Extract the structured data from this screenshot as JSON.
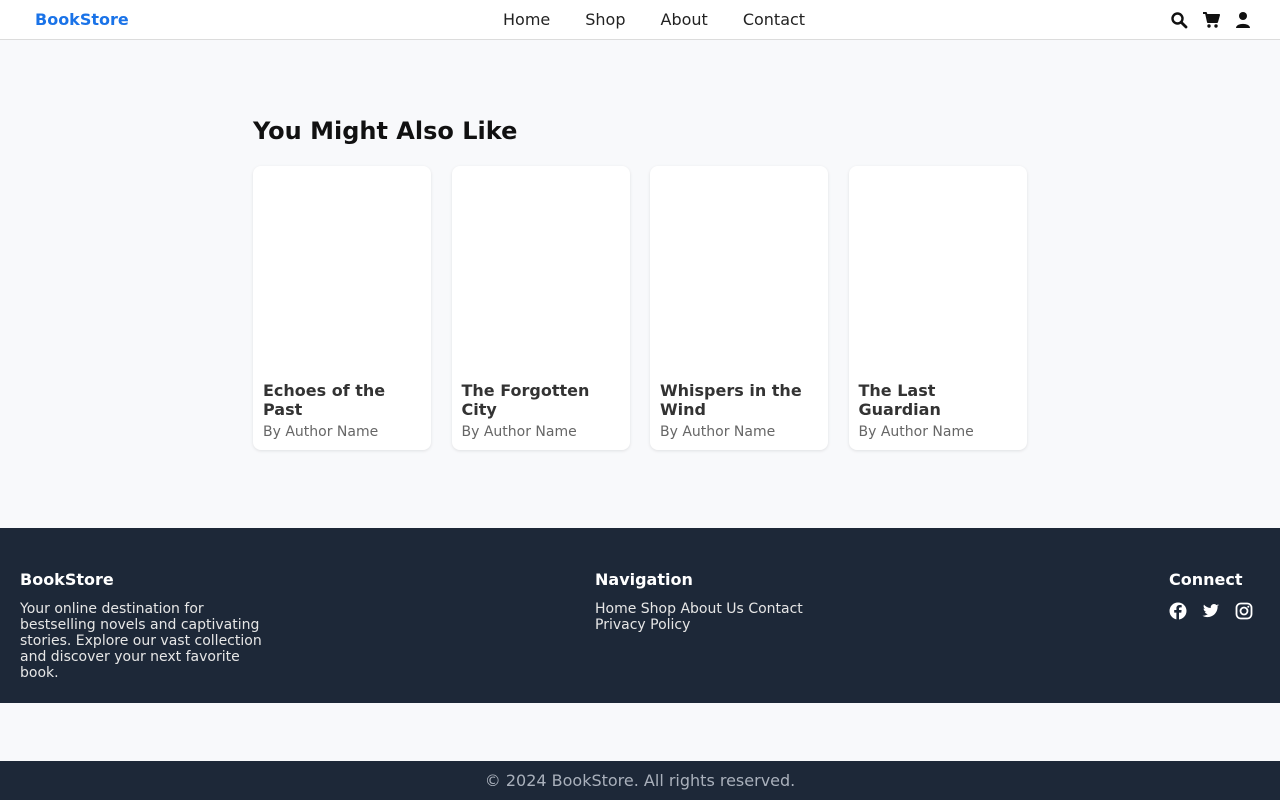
{
  "header": {
    "logo": "BookStore",
    "nav": [
      "Home",
      "Shop",
      "About",
      "Contact"
    ],
    "icons": [
      "search-icon",
      "cart-icon",
      "user-icon"
    ]
  },
  "recommendations": {
    "title": "You Might Also Like",
    "books": [
      {
        "title": "Echoes of the Past",
        "author": "By Author Name"
      },
      {
        "title": "The Forgotten City",
        "author": "By Author Name"
      },
      {
        "title": "Whispers in the Wind",
        "author": "By Author Name"
      },
      {
        "title": "The Last Guardian",
        "author": "By Author Name"
      }
    ]
  },
  "footer": {
    "about": {
      "heading": "BookStore",
      "text": "Your online destination for bestselling novels and captivating stories. Explore our vast collection and discover your next favorite book."
    },
    "navigation": {
      "heading": "Navigation",
      "links": [
        "Home",
        "Shop",
        "About Us",
        "Contact",
        "Privacy Policy"
      ]
    },
    "connect": {
      "heading": "Connect",
      "icons": [
        "facebook-icon",
        "twitter-icon",
        "instagram-icon"
      ]
    },
    "copyright": "© 2024 BookStore. All rights reserved."
  },
  "colors": {
    "brand": "#1a73e8",
    "footer_bg": "#1d2838",
    "page_bg": "#f8f9fb"
  }
}
